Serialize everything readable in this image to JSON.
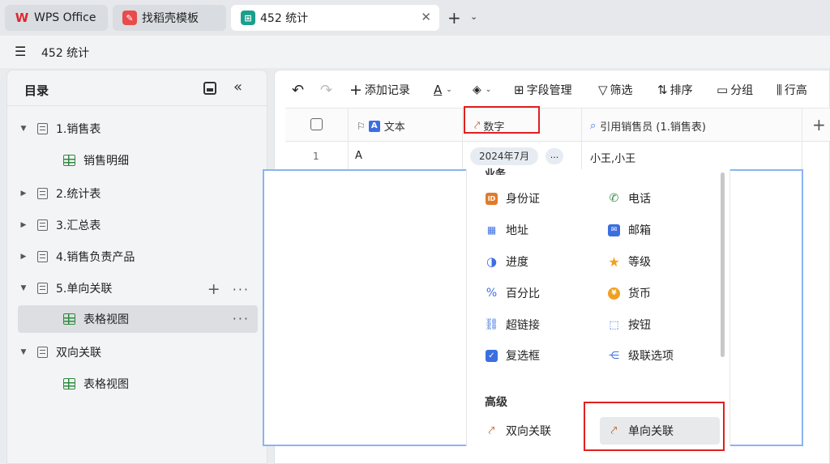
{
  "tabs": [
    {
      "label": "WPS Office",
      "icon": "wps-logo-icon",
      "color": "#e0262f"
    },
    {
      "label": "找稻壳模板",
      "icon": "docer-icon",
      "color": "#e84b4b"
    },
    {
      "label": "452 统计",
      "icon": "sheet-icon",
      "color": "#1a9f8c",
      "close": "✕"
    }
  ],
  "doc_title": "452 统计",
  "sidebar": {
    "title": "目录",
    "items": [
      {
        "label": "1.销售表",
        "type": "folder",
        "expanded": true
      },
      {
        "label": "销售明细",
        "type": "view"
      },
      {
        "label": "2.统计表",
        "type": "folder",
        "expanded": false
      },
      {
        "label": "3.汇总表",
        "type": "folder",
        "expanded": false
      },
      {
        "label": "4.销售负责产品",
        "type": "folder",
        "expanded": false
      },
      {
        "label": "5.单向关联",
        "type": "folder",
        "expanded": true
      },
      {
        "label": "表格视图",
        "type": "view",
        "selected": true
      },
      {
        "label": "双向关联",
        "type": "folder",
        "expanded": true
      },
      {
        "label": "表格视图",
        "type": "view"
      }
    ],
    "add_symbol": "+",
    "more_symbol": "···"
  },
  "toolbar": {
    "undo": "↶",
    "redo": "↷",
    "add_record": "添加记录",
    "field_manage": "字段管理",
    "filter": "筛选",
    "sort": "排序",
    "group": "分组",
    "row_height": "行高"
  },
  "grid": {
    "columns": [
      "文本",
      "数字",
      "引用销售员 (1.销售表)"
    ],
    "rows": [
      {
        "num": "1",
        "text": "A",
        "tag": "2024年7月",
        "more": "...",
        "ref": "小王,小王"
      }
    ]
  },
  "dropdown": {
    "section_business": "业务",
    "options_left": [
      {
        "label": "身份证",
        "icon": "id-card-icon",
        "color": "#e07b2a"
      },
      {
        "label": "地址",
        "icon": "building-icon",
        "color": "#3b6fe0"
      },
      {
        "label": "进度",
        "icon": "progress-icon",
        "color": "#3b6fe0"
      },
      {
        "label": "百分比",
        "icon": "percent-icon",
        "color": "#3b6fe0"
      },
      {
        "label": "超链接",
        "icon": "link-icon",
        "color": "#3b6fe0"
      },
      {
        "label": "复选框",
        "icon": "checkbox-icon",
        "color": "#3b6fe0"
      }
    ],
    "options_right": [
      {
        "label": "电话",
        "icon": "phone-icon",
        "color": "#2e8b3e"
      },
      {
        "label": "邮箱",
        "icon": "mail-icon",
        "color": "#3b6fe0"
      },
      {
        "label": "等级",
        "icon": "star-icon",
        "color": "#f0a020"
      },
      {
        "label": "货币",
        "icon": "currency-icon",
        "color": "#f0a020"
      },
      {
        "label": "按钮",
        "icon": "cursor-icon",
        "color": "#3b6fe0"
      },
      {
        "label": "级联选项",
        "icon": "cascade-icon",
        "color": "#3b6fe0"
      }
    ],
    "section_advanced": "高级",
    "adv_two_way": "双向关联",
    "adv_one_way": "单向关联"
  }
}
